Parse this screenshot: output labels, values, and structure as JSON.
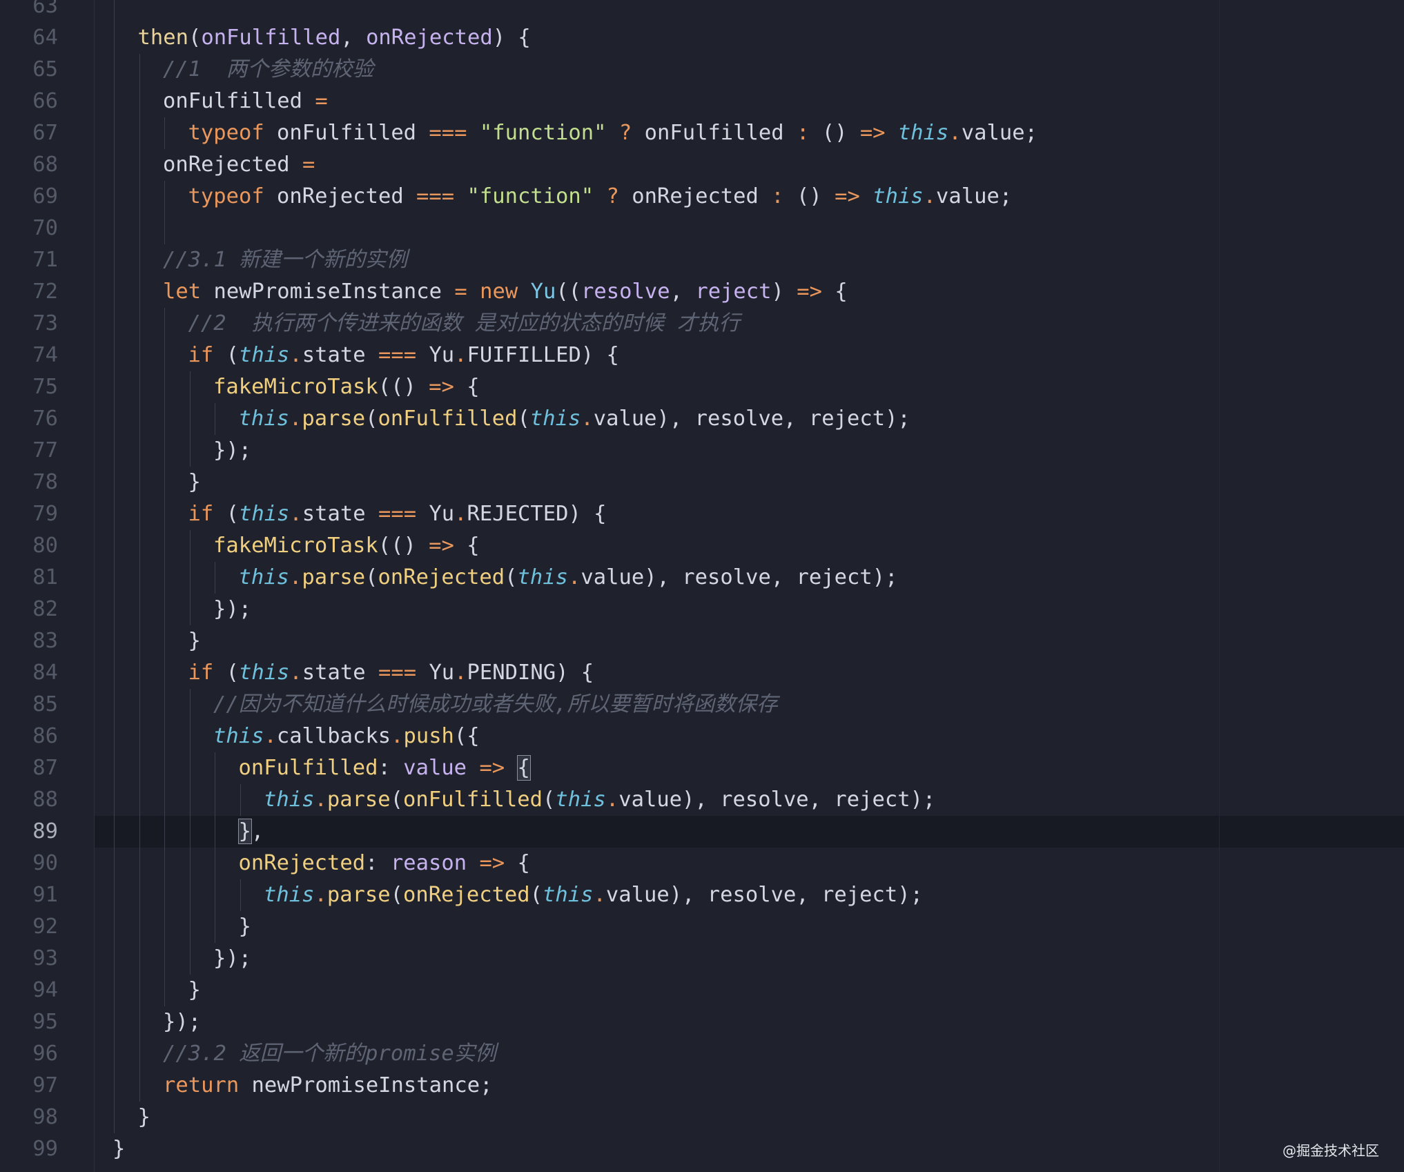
{
  "editor": {
    "current_line": 89,
    "colors": {
      "background": "#1f222c",
      "keyword": "#e9975c",
      "function": "#f0cf80",
      "parameter": "#c6b2ee",
      "this": "#6fc0dc",
      "string": "#c3de8f",
      "comment": "#5e6474"
    },
    "lines": [
      {
        "n": "63",
        "indent": 0,
        "tokens": []
      },
      {
        "n": "64",
        "indent": 1,
        "tokens": [
          [
            "def",
            "then"
          ],
          [
            "txt",
            "("
          ],
          [
            "param",
            "onFulfilled"
          ],
          [
            "txt",
            ", "
          ],
          [
            "param",
            "onRejected"
          ],
          [
            "txt",
            ") {"
          ]
        ]
      },
      {
        "n": "65",
        "indent": 2,
        "tokens": [
          [
            "cmt",
            "//1  两个参数的校验"
          ]
        ]
      },
      {
        "n": "66",
        "indent": 2,
        "tokens": [
          [
            "txt",
            "onFulfilled "
          ],
          [
            "op",
            "="
          ]
        ]
      },
      {
        "n": "67",
        "indent": 3,
        "tokens": [
          [
            "kw",
            "typeof"
          ],
          [
            "txt",
            " onFulfilled "
          ],
          [
            "op",
            "==="
          ],
          [
            "txt",
            " "
          ],
          [
            "str",
            "\"function\""
          ],
          [
            "txt",
            " "
          ],
          [
            "op",
            "?"
          ],
          [
            "txt",
            " onFulfilled "
          ],
          [
            "op",
            ":"
          ],
          [
            "txt",
            " () "
          ],
          [
            "op",
            "=>"
          ],
          [
            "txt",
            " "
          ],
          [
            "this",
            "this"
          ],
          [
            "dot",
            "."
          ],
          [
            "txt",
            "value;"
          ]
        ]
      },
      {
        "n": "68",
        "indent": 2,
        "tokens": [
          [
            "txt",
            "onRejected "
          ],
          [
            "op",
            "="
          ]
        ]
      },
      {
        "n": "69",
        "indent": 3,
        "tokens": [
          [
            "kw",
            "typeof"
          ],
          [
            "txt",
            " onRejected "
          ],
          [
            "op",
            "==="
          ],
          [
            "txt",
            " "
          ],
          [
            "str",
            "\"function\""
          ],
          [
            "txt",
            " "
          ],
          [
            "op",
            "?"
          ],
          [
            "txt",
            " onRejected "
          ],
          [
            "op",
            ":"
          ],
          [
            "txt",
            " () "
          ],
          [
            "op",
            "=>"
          ],
          [
            "txt",
            " "
          ],
          [
            "this",
            "this"
          ],
          [
            "dot",
            "."
          ],
          [
            "txt",
            "value;"
          ]
        ]
      },
      {
        "n": "70",
        "indent": 2,
        "tokens": []
      },
      {
        "n": "71",
        "indent": 2,
        "tokens": [
          [
            "cmt",
            "//3.1 新建一个新的实例"
          ]
        ]
      },
      {
        "n": "72",
        "indent": 2,
        "tokens": [
          [
            "kw",
            "let"
          ],
          [
            "txt",
            " newPromiseInstance "
          ],
          [
            "op",
            "="
          ],
          [
            "txt",
            " "
          ],
          [
            "kw",
            "new"
          ],
          [
            "txt",
            " "
          ],
          [
            "cls",
            "Yu"
          ],
          [
            "txt",
            "(("
          ],
          [
            "param",
            "resolve"
          ],
          [
            "txt",
            ", "
          ],
          [
            "param",
            "reject"
          ],
          [
            "txt",
            ") "
          ],
          [
            "op",
            "=>"
          ],
          [
            "txt",
            " {"
          ]
        ]
      },
      {
        "n": "73",
        "indent": 3,
        "tokens": [
          [
            "cmt",
            "//2  执行两个传进来的函数 是对应的状态的时候 才执行"
          ]
        ]
      },
      {
        "n": "74",
        "indent": 3,
        "tokens": [
          [
            "kw",
            "if"
          ],
          [
            "txt",
            " ("
          ],
          [
            "this",
            "this"
          ],
          [
            "dot",
            "."
          ],
          [
            "txt",
            "state "
          ],
          [
            "op",
            "==="
          ],
          [
            "txt",
            " Yu"
          ],
          [
            "dot",
            "."
          ],
          [
            "txt",
            "FUIFILLED) {"
          ]
        ]
      },
      {
        "n": "75",
        "indent": 4,
        "tokens": [
          [
            "fn",
            "fakeMicroTask"
          ],
          [
            "txt",
            "(() "
          ],
          [
            "op",
            "=>"
          ],
          [
            "txt",
            " {"
          ]
        ]
      },
      {
        "n": "76",
        "indent": 5,
        "tokens": [
          [
            "this",
            "this"
          ],
          [
            "dot",
            "."
          ],
          [
            "fn",
            "parse"
          ],
          [
            "txt",
            "("
          ],
          [
            "fn",
            "onFulfilled"
          ],
          [
            "txt",
            "("
          ],
          [
            "this",
            "this"
          ],
          [
            "dot",
            "."
          ],
          [
            "txt",
            "value), resolve, reject);"
          ]
        ]
      },
      {
        "n": "77",
        "indent": 4,
        "tokens": [
          [
            "txt",
            "});"
          ]
        ]
      },
      {
        "n": "78",
        "indent": 3,
        "tokens": [
          [
            "txt",
            "}"
          ]
        ]
      },
      {
        "n": "79",
        "indent": 3,
        "tokens": [
          [
            "kw",
            "if"
          ],
          [
            "txt",
            " ("
          ],
          [
            "this",
            "this"
          ],
          [
            "dot",
            "."
          ],
          [
            "txt",
            "state "
          ],
          [
            "op",
            "==="
          ],
          [
            "txt",
            " Yu"
          ],
          [
            "dot",
            "."
          ],
          [
            "txt",
            "REJECTED) {"
          ]
        ]
      },
      {
        "n": "80",
        "indent": 4,
        "tokens": [
          [
            "fn",
            "fakeMicroTask"
          ],
          [
            "txt",
            "(() "
          ],
          [
            "op",
            "=>"
          ],
          [
            "txt",
            " {"
          ]
        ]
      },
      {
        "n": "81",
        "indent": 5,
        "tokens": [
          [
            "this",
            "this"
          ],
          [
            "dot",
            "."
          ],
          [
            "fn",
            "parse"
          ],
          [
            "txt",
            "("
          ],
          [
            "fn",
            "onRejected"
          ],
          [
            "txt",
            "("
          ],
          [
            "this",
            "this"
          ],
          [
            "dot",
            "."
          ],
          [
            "txt",
            "value), resolve, reject);"
          ]
        ]
      },
      {
        "n": "82",
        "indent": 4,
        "tokens": [
          [
            "txt",
            "});"
          ]
        ]
      },
      {
        "n": "83",
        "indent": 3,
        "tokens": [
          [
            "txt",
            "}"
          ]
        ]
      },
      {
        "n": "84",
        "indent": 3,
        "tokens": [
          [
            "kw",
            "if"
          ],
          [
            "txt",
            " ("
          ],
          [
            "this",
            "this"
          ],
          [
            "dot",
            "."
          ],
          [
            "txt",
            "state "
          ],
          [
            "op",
            "==="
          ],
          [
            "txt",
            " Yu"
          ],
          [
            "dot",
            "."
          ],
          [
            "txt",
            "PENDING) {"
          ]
        ]
      },
      {
        "n": "85",
        "indent": 4,
        "tokens": [
          [
            "cmt",
            "//因为不知道什么时候成功或者失败,所以要暂时将函数保存"
          ]
        ]
      },
      {
        "n": "86",
        "indent": 4,
        "tokens": [
          [
            "this",
            "this"
          ],
          [
            "dot",
            "."
          ],
          [
            "txt",
            "callbacks"
          ],
          [
            "dot",
            "."
          ],
          [
            "fn",
            "push"
          ],
          [
            "txt",
            "({"
          ]
        ]
      },
      {
        "n": "87",
        "indent": 5,
        "tokens": [
          [
            "prop",
            "onFulfilled"
          ],
          [
            "txt",
            ": "
          ],
          [
            "param",
            "value"
          ],
          [
            "txt",
            " "
          ],
          [
            "op",
            "=>"
          ],
          [
            "txt",
            " "
          ],
          [
            "bm",
            "{"
          ]
        ]
      },
      {
        "n": "88",
        "indent": 6,
        "tokens": [
          [
            "this",
            "this"
          ],
          [
            "dot",
            "."
          ],
          [
            "fn",
            "parse"
          ],
          [
            "txt",
            "("
          ],
          [
            "fn",
            "onFulfilled"
          ],
          [
            "txt",
            "("
          ],
          [
            "this",
            "this"
          ],
          [
            "dot",
            "."
          ],
          [
            "txt",
            "value), resolve, reject);"
          ]
        ]
      },
      {
        "n": "89",
        "indent": 5,
        "tokens": [
          [
            "bm",
            "}"
          ],
          [
            "txt",
            ","
          ]
        ]
      },
      {
        "n": "90",
        "indent": 5,
        "tokens": [
          [
            "prop",
            "onRejected"
          ],
          [
            "txt",
            ": "
          ],
          [
            "param",
            "reason"
          ],
          [
            "txt",
            " "
          ],
          [
            "op",
            "=>"
          ],
          [
            "txt",
            " {"
          ]
        ]
      },
      {
        "n": "91",
        "indent": 6,
        "tokens": [
          [
            "this",
            "this"
          ],
          [
            "dot",
            "."
          ],
          [
            "fn",
            "parse"
          ],
          [
            "txt",
            "("
          ],
          [
            "fn",
            "onRejected"
          ],
          [
            "txt",
            "("
          ],
          [
            "this",
            "this"
          ],
          [
            "dot",
            "."
          ],
          [
            "txt",
            "value), resolve, reject);"
          ]
        ]
      },
      {
        "n": "92",
        "indent": 5,
        "tokens": [
          [
            "txt",
            "}"
          ]
        ]
      },
      {
        "n": "93",
        "indent": 4,
        "tokens": [
          [
            "txt",
            "});"
          ]
        ]
      },
      {
        "n": "94",
        "indent": 3,
        "tokens": [
          [
            "txt",
            "}"
          ]
        ]
      },
      {
        "n": "95",
        "indent": 2,
        "tokens": [
          [
            "txt",
            "});"
          ]
        ]
      },
      {
        "n": "96",
        "indent": 2,
        "tokens": [
          [
            "cmt",
            "//3.2 返回一个新的promise实例"
          ]
        ]
      },
      {
        "n": "97",
        "indent": 2,
        "tokens": [
          [
            "kw",
            "return"
          ],
          [
            "txt",
            " newPromiseInstance;"
          ]
        ]
      },
      {
        "n": "98",
        "indent": 1,
        "tokens": [
          [
            "txt",
            "}"
          ]
        ]
      },
      {
        "n": "99",
        "indent": 0,
        "tokens": [
          [
            "txt",
            "}"
          ]
        ]
      }
    ]
  },
  "watermark": "@掘金技术社区"
}
